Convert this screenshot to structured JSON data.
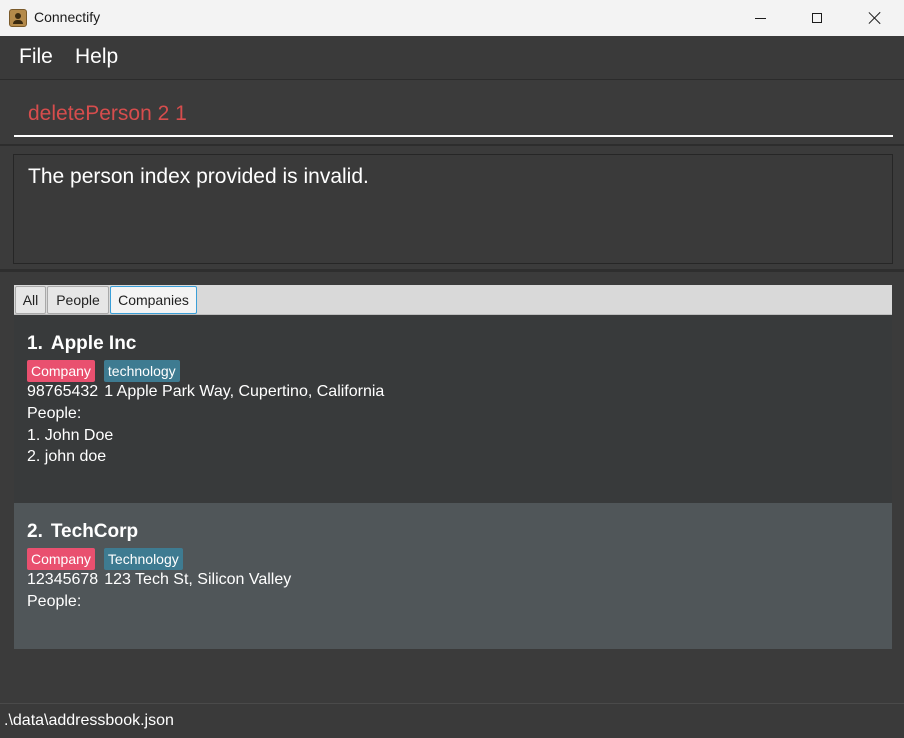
{
  "window": {
    "title": "Connectify",
    "controls": {
      "minimize": "minimize-icon",
      "maximize": "maximize-icon",
      "close": "close-icon"
    }
  },
  "menu": {
    "items": [
      {
        "label": "File"
      },
      {
        "label": "Help"
      }
    ]
  },
  "command": {
    "value": "deletePerson 2 1"
  },
  "result": {
    "message": "The person index provided is invalid."
  },
  "tabs": [
    {
      "label": "All",
      "selected": false
    },
    {
      "label": "People",
      "selected": false
    },
    {
      "label": "Companies",
      "selected": true
    }
  ],
  "companies": [
    {
      "index": "1.",
      "name": "Apple Inc",
      "tags": [
        "Company",
        "technology"
      ],
      "phone": "98765432",
      "address": "1 Apple Park Way, Cupertino, California",
      "people_label": "People:",
      "people": [
        "1. John Doe",
        "2. john doe"
      ]
    },
    {
      "index": "2.",
      "name": "TechCorp",
      "tags": [
        "Company",
        "Technology"
      ],
      "phone": "12345678",
      "address": "123 Tech St, Silicon Valley",
      "people_label": "People:",
      "people": []
    }
  ],
  "colors": {
    "command_text": "#d64d4d",
    "tag_company": "#e9506f",
    "tag_industry": "#3e7b91",
    "selected_tab_border": "#3a9fd8"
  },
  "status": {
    "file_path": ".\\data\\addressbook.json"
  }
}
